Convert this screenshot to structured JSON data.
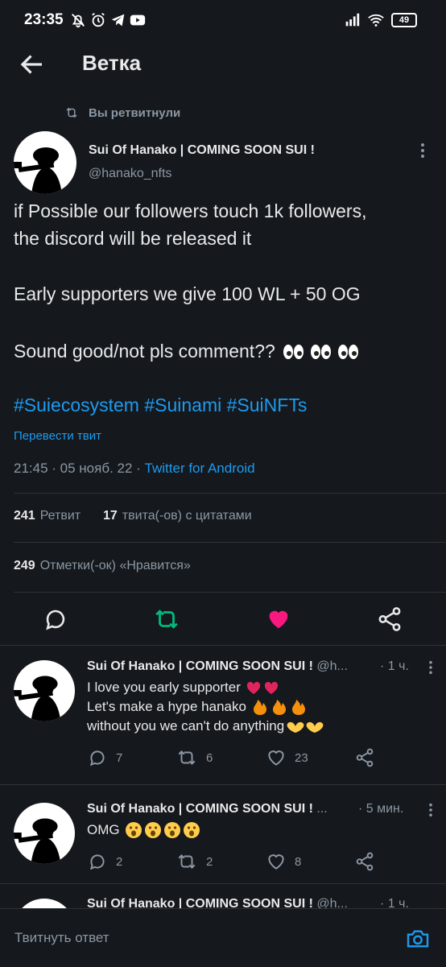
{
  "status_bar": {
    "time": "23:35",
    "battery": "49"
  },
  "header": {
    "title": "Ветка"
  },
  "retweet_notice": "Вы ретвитнули",
  "tweet": {
    "name": "Sui Of Hanako | COMING SOON SUI !",
    "handle": "@hanako_nfts",
    "line1": "if Possible our followers touch 1k followers,",
    "line2": "the discord will be released it",
    "line3": "Early supporters we give 100 WL + 50 OG",
    "line4": "Sound good/not pls comment??",
    "hashtags": "#Suiecosystem #Suinami #SuiNFTs",
    "translate": "Перевести твит",
    "time": "21:45",
    "date": "05 нояб. 22",
    "source": "Twitter for Android",
    "retweets_count": "241",
    "retweets_label": "Ретвит",
    "quotes_count": "17",
    "quotes_label": "твита(-ов) с цитатами",
    "likes_count": "249",
    "likes_label": "Отметки(-ок) «Нравится»"
  },
  "replies": [
    {
      "name": "Sui Of Hanako | COMING SOON SUI !",
      "handle": "@h...",
      "time": "· 1 ч.",
      "line1": "I love you early supporter",
      "line2": "Let's make a hype hanako",
      "line3": "without you we can't do anything",
      "replies": "7",
      "retweets": "6",
      "likes": "23"
    },
    {
      "name": "Sui Of Hanako | COMING SOON SUI !",
      "handle": "...",
      "time": "· 5 мин.",
      "line1": "OMG",
      "replies": "2",
      "retweets": "2",
      "likes": "8"
    },
    {
      "name": "Sui Of Hanako | COMING SOON SUI !",
      "handle": "@h...",
      "time": "· 1 ч."
    }
  ],
  "composer": {
    "placeholder": "Твитнуть ответ"
  },
  "colors": {
    "accent": "#1d9bf0",
    "retweet": "#00ba7c",
    "like": "#f91880",
    "background": "#15181c"
  },
  "icons": [
    "back-arrow-icon",
    "retweet-icon",
    "reply-icon",
    "heart-icon",
    "share-icon",
    "more-icon",
    "camera-icon"
  ]
}
